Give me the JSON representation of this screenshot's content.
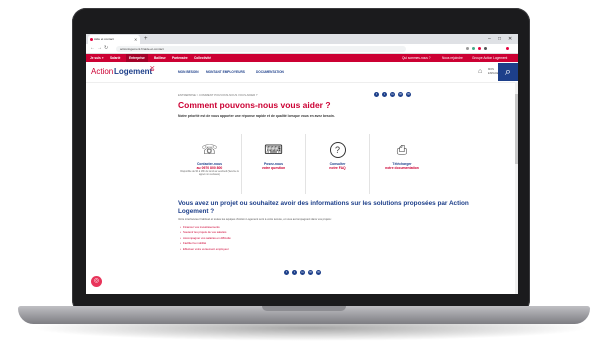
{
  "browser": {
    "tab_title": "Aide et contact",
    "new_tab": "+",
    "url": "actionlogement.fr/aide-et-contact",
    "window_controls": [
      "–",
      "□",
      "✕"
    ]
  },
  "topnav": {
    "items": [
      "Je suis »",
      "Salarié",
      "Entreprise",
      "Bailleur",
      "Partenaire",
      "Collectivité"
    ],
    "right_items": [
      "Qui sommes-nous ?",
      "Nous rejoindre",
      "Groupe Action Logement"
    ]
  },
  "header": {
    "logo_part1": "Action",
    "logo_part2": "Logement",
    "menu": [
      "MON BESOIN",
      "MONTANT EMPLOYEURS",
      "DOCUMENTATION"
    ],
    "account_label": "MON ESPACE",
    "search_icon": "search-icon"
  },
  "page": {
    "breadcrumb": "ENTREPRISE  >  COMMENT POUVONS-NOUS VOUS AIDER ?",
    "title": "Comment pouvons-nous vous aider ?",
    "lead": "Notre priorité est de vous apporter une réponse rapide et de qualité lorsque vous en avez besoin.",
    "share_icons": [
      "f",
      "t",
      "in",
      "✉",
      "✉"
    ],
    "cards": [
      {
        "icon": "headset-icon",
        "glyph": "☏",
        "l1": "Contacter-nous",
        "l2": "au 0970 800 800",
        "l3": "Disponible de 9h à 18h du lundi au vendredi (Service & appel non surtaxés)"
      },
      {
        "icon": "laptop-icon",
        "glyph": "⌨",
        "l1": "Posez-nous",
        "l2": "votre question",
        "l3": ""
      },
      {
        "icon": "question-icon",
        "glyph": "?",
        "l1": "Consulter",
        "l2": "notre FAQ",
        "l3": ""
      },
      {
        "icon": "document-icon",
        "glyph": "⎙",
        "l1": "Télécharger",
        "l2": "notre documentation",
        "l3": ""
      }
    ],
    "section_title": "Vous avez un projet ou souhaitez avoir des informations sur les solutions proposées par Action Logement ?",
    "section_text": "Votre interlocuteur habituel et toutes les équipes d'Action Logement sont à votre écoute, et vous accompagnent dans vos projets :",
    "links": [
      "Financer vos investissements",
      "Soutenir les projets de vos salariés",
      "Accompagner vos salariés en difficulté",
      "Faciliter la mobilité",
      "Effectuer votre versement employeur"
    ],
    "fab_icon": "chat-icon"
  }
}
